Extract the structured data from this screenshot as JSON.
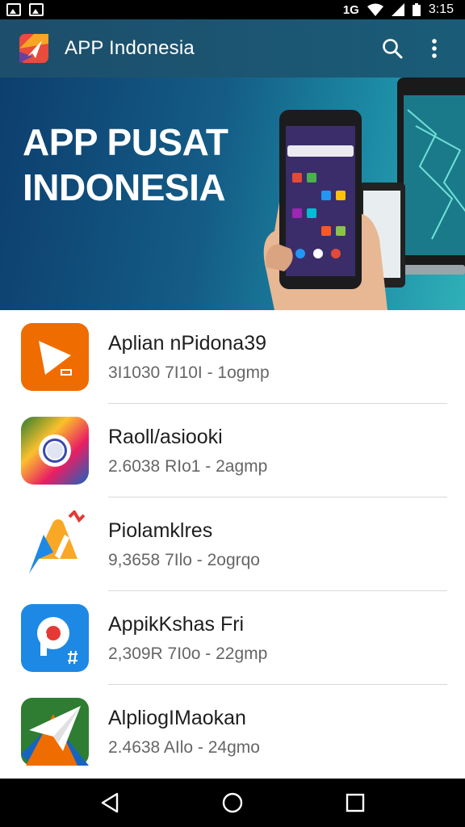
{
  "status_bar": {
    "time": "3:15",
    "network": "1G",
    "left_icons": [
      "image-icon",
      "image-icon"
    ],
    "right_icons": [
      "wifi-icon",
      "signal-icon",
      "battery-icon"
    ]
  },
  "app_bar": {
    "title": "APP Indonesia",
    "logo_icon": "app-logo-icon",
    "actions": [
      "search-icon",
      "more-vert-icon"
    ]
  },
  "banner": {
    "line1": "APP PUSAT",
    "line2": "INDONESIA"
  },
  "apps": [
    {
      "name": "Aplian nPidona39",
      "meta": "3I1030 7I10I - 1ogmp",
      "icon": "play-arrow-icon"
    },
    {
      "name": "Raoll/asiooki",
      "meta": "2.6038 RIo1 - 2agmp",
      "icon": "circle-ring-icon"
    },
    {
      "name": "Piolamklres",
      "meta": "9,3658 7Ilo - 2ogrqo",
      "icon": "pencil-chat-icon"
    },
    {
      "name": "AppikKshas Fri",
      "meta": "2,309R 7I0o - 22gmp",
      "icon": "p-letter-icon"
    },
    {
      "name": "AlpliogIMaokan",
      "meta": "2.4638 AIlo - 24gmo",
      "icon": "paper-plane-icon"
    }
  ],
  "nav_bar": {
    "buttons": [
      "back-icon",
      "home-icon",
      "recents-icon"
    ]
  },
  "colors": {
    "app_bar": "#1d4e6b",
    "banner_start": "#0d3e6e",
    "banner_end": "#2fb0b8",
    "divider": "#d8d8d8"
  }
}
